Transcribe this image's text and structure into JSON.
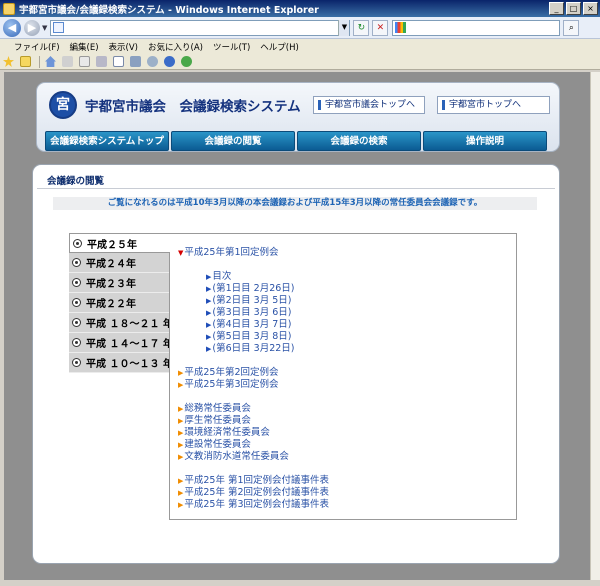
{
  "window": {
    "title": "宇都宮市議会/会議録検索システム - Windows Internet Explorer",
    "buttons": [
      "_",
      "□",
      "×"
    ]
  },
  "browser": {
    "address_value": "",
    "nav_glyphs": {
      "back": "◀",
      "forward": "▶",
      "dropdown": "▼",
      "refresh": "↻",
      "stop": "✕",
      "search_go": "⌕"
    },
    "menu": [
      "ファイル(F)",
      "編集(E)",
      "表示(V)",
      "お気に入り(A)",
      "ツール(T)",
      "ヘルプ(H)"
    ],
    "toolbar_icons": [
      "favorites-star-icon",
      "add-favorites-icon",
      "home-icon",
      "feeds-icon",
      "read-mail-icon",
      "print-icon",
      "page-icon",
      "tools-icon",
      "research-icon",
      "help-icon",
      "messenger-icon"
    ]
  },
  "site": {
    "logo_text": "宮",
    "name": "宇都宮市議会　会議録検索システム",
    "header_links": [
      "宇都宮市議会トップへ",
      "宇都宮市トップへ"
    ],
    "nav_tabs": [
      "会議録検索システムトップ",
      "会議録の閲覧",
      "会議録の検索",
      "操作説明"
    ]
  },
  "main": {
    "section_title": "会議録の閲覧",
    "notice": "ご覧になれるのは平成10年3月以降の本会議録および平成15年3月以降の常任委員会会議録です。",
    "years": [
      {
        "label": "平成２５年",
        "active": true
      },
      {
        "label": "平成２４年",
        "active": false
      },
      {
        "label": "平成２３年",
        "active": false
      },
      {
        "label": "平成２２年",
        "active": false
      },
      {
        "label": "平成 １８～２１ 年",
        "active": false
      },
      {
        "label": "平成 １４～１７ 年",
        "active": false
      },
      {
        "label": "平成 １０～１３ 年",
        "active": false
      }
    ],
    "sessions": {
      "open_session": {
        "marker": "▼",
        "label": "平成25年第1回定例会"
      },
      "days": [
        {
          "marker": "▶",
          "label": "目次"
        },
        {
          "marker": "▶",
          "label": "(第1日目 2月26日)"
        },
        {
          "marker": "▶",
          "label": "(第2日目 3月 5日)"
        },
        {
          "marker": "▶",
          "label": "(第3日目 3月 6日)"
        },
        {
          "marker": "▶",
          "label": "(第4日目 3月 7日)"
        },
        {
          "marker": "▶",
          "label": "(第5日目 3月 8日)"
        },
        {
          "marker": "▶",
          "label": "(第6日目 3月22日)"
        }
      ],
      "other_sessions": [
        {
          "marker": "▶",
          "label": "平成25年第2回定例会"
        },
        {
          "marker": "▶",
          "label": "平成25年第3回定例会"
        }
      ],
      "committees": [
        {
          "marker": "▶",
          "label": "総務常任委員会"
        },
        {
          "marker": "▶",
          "label": "厚生常任委員会"
        },
        {
          "marker": "▶",
          "label": "環境経済常任委員会"
        },
        {
          "marker": "▶",
          "label": "建設常任委員会"
        },
        {
          "marker": "▶",
          "label": "文教消防水道常任委員会"
        }
      ],
      "attached_items": [
        {
          "marker": "▶",
          "label": "平成25年 第1回定例会付議事件表"
        },
        {
          "marker": "▶",
          "label": "平成25年 第2回定例会付議事件表"
        },
        {
          "marker": "▶",
          "label": "平成25年 第3回定例会付議事件表"
        }
      ]
    }
  },
  "colors": {
    "link": "#2a52a6",
    "nav_tab": "#0b5b93",
    "notice_text": "#1d63b4",
    "marker_open": "#d40000",
    "marker_day": "#1f4db8",
    "marker_item": "#f08c00"
  }
}
